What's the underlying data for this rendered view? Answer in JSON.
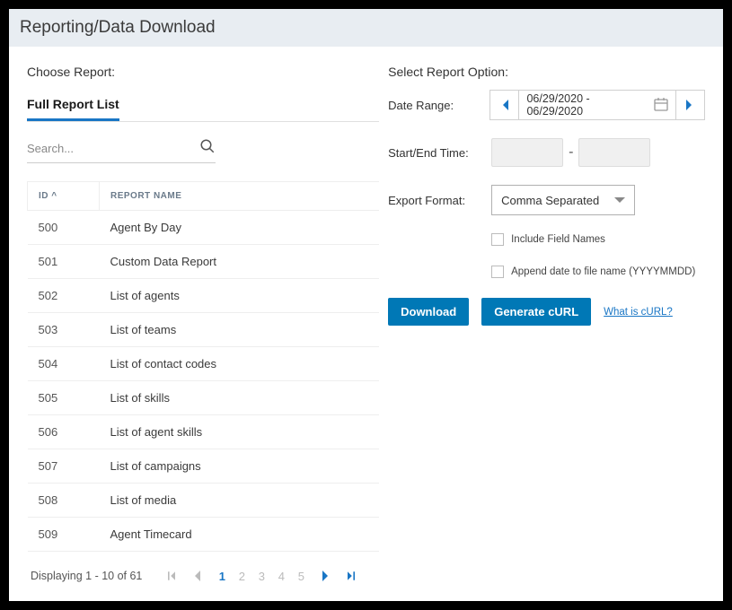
{
  "header": {
    "title": "Reporting/Data Download"
  },
  "left": {
    "chooseLabel": "Choose Report:",
    "tabLabel": "Full Report List",
    "searchPlaceholder": "Search...",
    "columns": {
      "id": "ID ^",
      "name": "REPORT NAME"
    },
    "rows": [
      {
        "id": "500",
        "name": "Agent By Day"
      },
      {
        "id": "501",
        "name": "Custom Data Report"
      },
      {
        "id": "502",
        "name": "List of agents"
      },
      {
        "id": "503",
        "name": "List of teams"
      },
      {
        "id": "504",
        "name": "List of contact codes"
      },
      {
        "id": "505",
        "name": "List of skills"
      },
      {
        "id": "506",
        "name": "List of agent skills"
      },
      {
        "id": "507",
        "name": "List of campaigns"
      },
      {
        "id": "508",
        "name": "List of media"
      },
      {
        "id": "509",
        "name": "Agent Timecard"
      }
    ],
    "pager": {
      "info": "Displaying 1 - 10 of 61",
      "pages": [
        "1",
        "2",
        "3",
        "4",
        "5"
      ],
      "current": "1"
    }
  },
  "right": {
    "selectLabel": "Select Report Option:",
    "dateRangeLabel": "Date Range:",
    "dateRangeValue": "06/29/2020 - 06/29/2020",
    "startEndLabel": "Start/End Time:",
    "timeSep": "-",
    "exportLabel": "Export Format:",
    "exportValue": "Comma Separated",
    "includeFields": "Include Field Names",
    "appendDate": "Append date to file name (YYYYMMDD)",
    "downloadBtn": "Download",
    "curlBtn": "Generate cURL",
    "curlLink": "What is cURL?"
  }
}
